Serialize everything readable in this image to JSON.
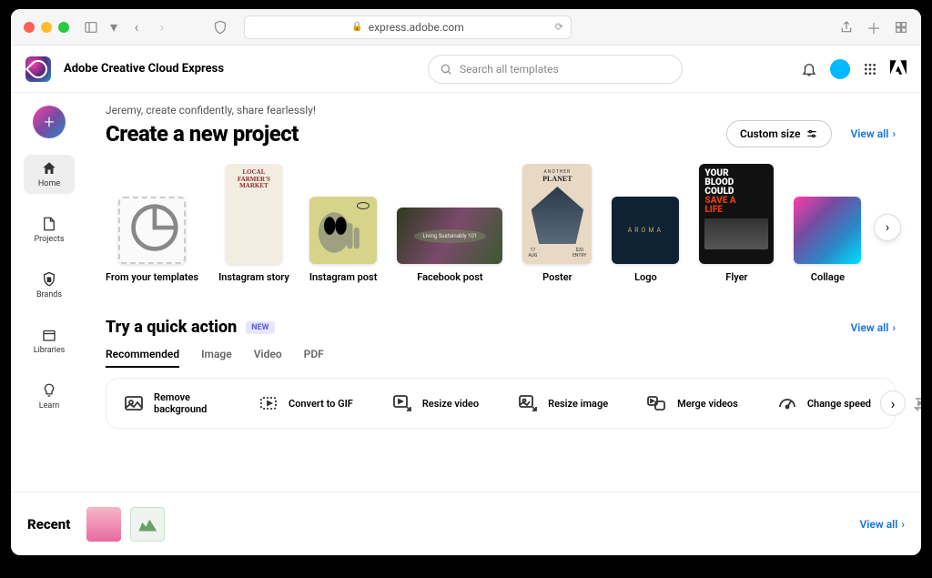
{
  "browser": {
    "url": "express.adobe.com"
  },
  "header": {
    "app_title": "Adobe Creative Cloud Express",
    "search_placeholder": "Search all templates"
  },
  "sidebar": {
    "items": [
      {
        "label": "Home",
        "icon": "home"
      },
      {
        "label": "Projects",
        "icon": "file"
      },
      {
        "label": "Brands",
        "icon": "shield"
      },
      {
        "label": "Libraries",
        "icon": "library"
      },
      {
        "label": "Learn",
        "icon": "bulb"
      }
    ]
  },
  "main": {
    "greeting": "Jeremy, create confidently, share fearlessly!",
    "heading": "Create a new project",
    "custom_size_label": "Custom size",
    "view_all_label": "View all",
    "templates": [
      {
        "label": "From your templates"
      },
      {
        "label": "Instagram story"
      },
      {
        "label": "Instagram post"
      },
      {
        "label": "Facebook post"
      },
      {
        "label": "Poster"
      },
      {
        "label": "Logo"
      },
      {
        "label": "Flyer"
      },
      {
        "label": "Collage"
      }
    ]
  },
  "quick": {
    "title": "Try a quick action",
    "badge": "NEW",
    "tabs": [
      {
        "label": "Recommended"
      },
      {
        "label": "Image"
      },
      {
        "label": "Video"
      },
      {
        "label": "PDF"
      }
    ],
    "actions": [
      {
        "label": "Remove background"
      },
      {
        "label": "Convert to GIF"
      },
      {
        "label": "Resize video"
      },
      {
        "label": "Resize image"
      },
      {
        "label": "Merge videos"
      },
      {
        "label": "Change speed"
      }
    ]
  },
  "recent": {
    "title": "Recent"
  }
}
